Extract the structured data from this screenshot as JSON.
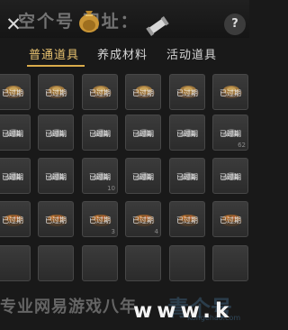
{
  "header": {
    "watermark_top": "空个号 网址：",
    "close_symbol": "✕",
    "help_symbol": "?"
  },
  "tabs": [
    {
      "label": "普通道具",
      "active": true
    },
    {
      "label": "养成材料",
      "active": false
    },
    {
      "label": "活动道具",
      "active": false
    }
  ],
  "colors": {
    "active_tab": "#e8c270",
    "tab_underline": "#d9ab4b",
    "slot_background": "#333333",
    "expired_text": "#e8e8e8"
  },
  "items": {
    "rows": [
      [
        {
          "icon": "treasure-bowl-icon",
          "expired_label": "已过期",
          "count": ""
        },
        {
          "icon": "treasure-bowl-icon",
          "expired_label": "已过期",
          "count": ""
        },
        {
          "icon": "treasure-bowl-icon",
          "expired_label": "已过期",
          "count": ""
        },
        {
          "icon": "treasure-bowl-icon",
          "expired_label": "已过期",
          "count": ""
        },
        {
          "icon": "treasure-bowl-icon",
          "expired_label": "已过期",
          "count": ""
        },
        {
          "icon": "treasure-bowl-icon",
          "expired_label": "已过期",
          "count": ""
        }
      ],
      [
        {
          "icon": "dumpling-icon",
          "expired_label": "已过期",
          "count": ""
        },
        {
          "icon": "dumpling-icon",
          "expired_label": "已过期",
          "count": ""
        },
        {
          "icon": "dumpling-icon",
          "expired_label": "已过期",
          "count": ""
        },
        {
          "icon": "dumpling-icon",
          "expired_label": "已过期",
          "count": ""
        },
        {
          "icon": "dumpling-icon",
          "expired_label": "已过期",
          "count": ""
        },
        {
          "icon": "dumpling-icon",
          "expired_label": "已过期",
          "count": "62"
        }
      ],
      [
        {
          "icon": "dumpling-icon",
          "expired_label": "已过期",
          "count": ""
        },
        {
          "icon": "dumpling-icon",
          "expired_label": "已过期",
          "count": ""
        },
        {
          "icon": "dumpling-icon",
          "expired_label": "已过期",
          "count": "10"
        },
        {
          "icon": "dumpling-icon",
          "expired_label": "已过期",
          "count": ""
        },
        {
          "icon": "dumpling-icon",
          "expired_label": "已过期",
          "count": ""
        },
        {
          "icon": "dumpling-icon",
          "expired_label": "已过期",
          "count": ""
        }
      ],
      [
        {
          "icon": "food-bowl-icon",
          "expired_label": "已过期",
          "count": ""
        },
        {
          "icon": "food-bowl-icon",
          "expired_label": "已过期",
          "count": ""
        },
        {
          "icon": "food-bowl-icon",
          "expired_label": "已过期",
          "count": "3"
        },
        {
          "icon": "food-bowl-icon",
          "expired_label": "已过期",
          "count": "4"
        },
        {
          "icon": "food-bowl-icon",
          "expired_label": "已过期",
          "count": ""
        },
        {
          "icon": "food-bowl-icon",
          "expired_label": "已过期",
          "count": ""
        }
      ],
      [
        {
          "icon": "",
          "expired_label": "",
          "count": ""
        },
        {
          "icon": "",
          "expired_label": "",
          "count": ""
        },
        {
          "icon": "",
          "expired_label": "",
          "count": ""
        },
        {
          "icon": "",
          "expired_label": "",
          "count": ""
        },
        {
          "icon": "",
          "expired_label": "",
          "count": ""
        },
        {
          "icon": "",
          "expired_label": "",
          "count": ""
        }
      ]
    ]
  },
  "watermark_bottom": {
    "text": "专业网易游戏八年",
    "url": "www.k",
    "logo": "青个号",
    "logo_sub": "Kongehao.com"
  }
}
